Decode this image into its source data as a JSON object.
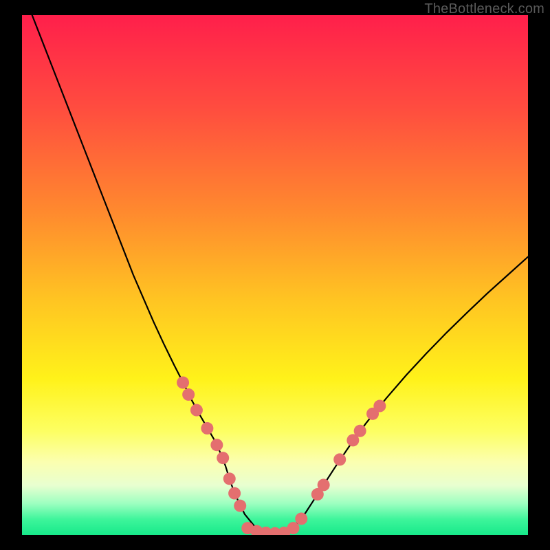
{
  "watermark": "TheBottleneck.com",
  "chart_data": {
    "type": "line",
    "title": "",
    "xlabel": "",
    "ylabel": "",
    "xlim": [
      0,
      100
    ],
    "ylim": [
      0,
      100
    ],
    "grid": false,
    "legend": false,
    "background_gradient": {
      "stops": [
        {
          "offset": 0.0,
          "color": "#ff1f4b"
        },
        {
          "offset": 0.18,
          "color": "#ff4d3f"
        },
        {
          "offset": 0.38,
          "color": "#ff8a2e"
        },
        {
          "offset": 0.55,
          "color": "#ffc522"
        },
        {
          "offset": 0.7,
          "color": "#fff21a"
        },
        {
          "offset": 0.8,
          "color": "#fdff62"
        },
        {
          "offset": 0.86,
          "color": "#fbffb0"
        },
        {
          "offset": 0.905,
          "color": "#e8ffd0"
        },
        {
          "offset": 0.94,
          "color": "#9cffc0"
        },
        {
          "offset": 0.97,
          "color": "#3ef59b"
        },
        {
          "offset": 1.0,
          "color": "#17e98a"
        }
      ]
    },
    "series": [
      {
        "name": "bottleneck-curve",
        "color": "#000000",
        "width": 2.2,
        "x": [
          2,
          4,
          6,
          8,
          10,
          12,
          14,
          16,
          18,
          20,
          22,
          24,
          26,
          28,
          30,
          32,
          33.5,
          35,
          36.5,
          38,
          39.2,
          40.2,
          41,
          42,
          44,
          46,
          48,
          49.5,
          50.5,
          52,
          54,
          56,
          58,
          60,
          62,
          65,
          68,
          72,
          76,
          80,
          84,
          88,
          92,
          96,
          100
        ],
        "y": [
          100,
          95,
          90,
          85,
          80,
          75,
          70,
          65,
          60,
          55,
          50,
          45.5,
          41,
          36.8,
          32.8,
          29,
          26,
          23.3,
          20.8,
          18.3,
          15.8,
          13.3,
          10.8,
          8,
          4,
          1.6,
          0.6,
          0.3,
          0.3,
          0.6,
          1.8,
          4.2,
          7.2,
          10.2,
          13.2,
          17.5,
          21.5,
          26.3,
          30.8,
          35,
          39,
          42.8,
          46.5,
          50,
          53.5
        ]
      }
    ],
    "markers": {
      "name": "highlighted-points",
      "color": "#e46f6f",
      "radius": 9,
      "points": [
        {
          "x": 31.8,
          "y": 29.3
        },
        {
          "x": 32.9,
          "y": 27.0
        },
        {
          "x": 34.5,
          "y": 24.0
        },
        {
          "x": 36.6,
          "y": 20.5
        },
        {
          "x": 38.5,
          "y": 17.3
        },
        {
          "x": 39.7,
          "y": 14.8
        },
        {
          "x": 41.0,
          "y": 10.8
        },
        {
          "x": 42.0,
          "y": 8.0
        },
        {
          "x": 43.1,
          "y": 5.6
        },
        {
          "x": 44.6,
          "y": 1.3
        },
        {
          "x": 46.4,
          "y": 0.7
        },
        {
          "x": 48.2,
          "y": 0.4
        },
        {
          "x": 50.0,
          "y": 0.3
        },
        {
          "x": 51.8,
          "y": 0.4
        },
        {
          "x": 53.6,
          "y": 1.3
        },
        {
          "x": 55.2,
          "y": 3.1
        },
        {
          "x": 58.4,
          "y": 7.8
        },
        {
          "x": 59.6,
          "y": 9.6
        },
        {
          "x": 62.8,
          "y": 14.5
        },
        {
          "x": 65.4,
          "y": 18.2
        },
        {
          "x": 66.8,
          "y": 20.0
        },
        {
          "x": 69.3,
          "y": 23.3
        },
        {
          "x": 70.7,
          "y": 24.8
        }
      ]
    }
  }
}
